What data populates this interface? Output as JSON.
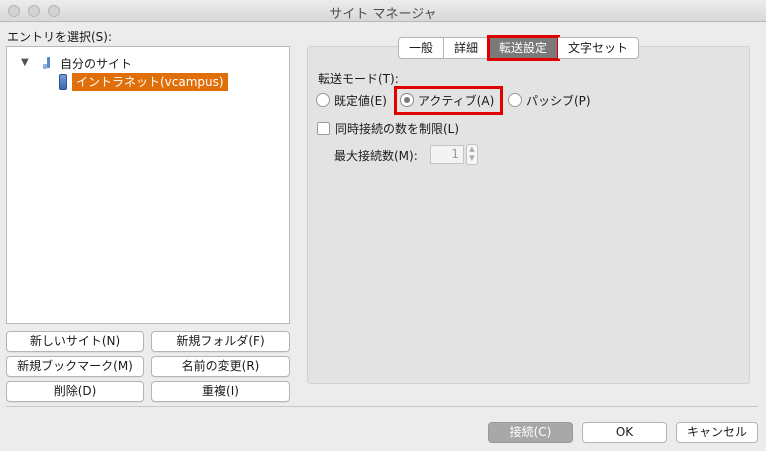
{
  "window": {
    "title": "サイト マネージャ"
  },
  "left": {
    "select_entry_label": "エントリを選択(S):",
    "tree": {
      "root_label": "自分のサイト",
      "child_label": "イントラネット(vcampus)"
    },
    "buttons": {
      "new_site": "新しいサイト(N)",
      "new_folder": "新規フォルダ(F)",
      "new_bookmark": "新規ブックマーク(M)",
      "rename": "名前の変更(R)",
      "delete": "削除(D)",
      "duplicate": "重複(I)"
    }
  },
  "tabs": [
    {
      "label": "一般"
    },
    {
      "label": "詳細"
    },
    {
      "label": "転送設定"
    },
    {
      "label": "文字セット"
    }
  ],
  "transfer": {
    "mode_label": "転送モード(T):",
    "options": {
      "default": "既定値(E)",
      "active": "アクティブ(A)",
      "passive": "パッシブ(P)"
    },
    "limit_label": "同時接続の数を制限(L)",
    "max_connections_label": "最大接続数(M):",
    "max_connections_value": "1"
  },
  "footer": {
    "connect": "接続(C)",
    "ok": "OK",
    "cancel": "キャンセル"
  },
  "colors": {
    "selection": "#e06f0a",
    "highlight": "#e00000",
    "active_tab": "#7a7a7a"
  }
}
